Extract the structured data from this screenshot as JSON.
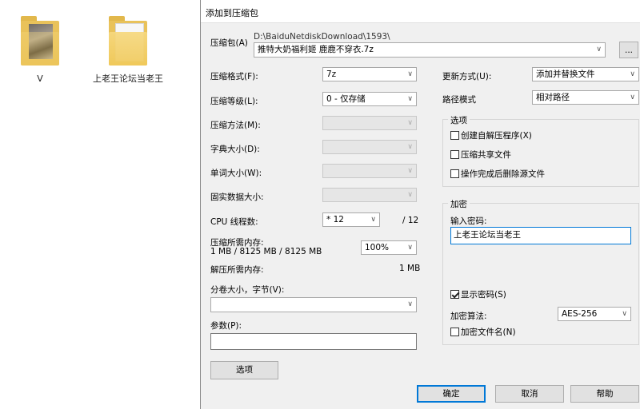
{
  "desktop": {
    "icons": [
      {
        "label": "V"
      },
      {
        "label": "上老王论坛当老王"
      }
    ]
  },
  "dialog": {
    "title": "添加到压缩包",
    "archive": {
      "label": "压缩包(A)",
      "path": "D:\\BaiduNetdiskDownload\\1593\\",
      "name": "推特大奶福利姬 鹿鹿不穿衣.7z",
      "browse": "..."
    },
    "format": {
      "label": "压缩格式(F):",
      "value": "7z"
    },
    "level": {
      "label": "压缩等级(L):",
      "value": "0 - 仅存储"
    },
    "method": {
      "label": "压缩方法(M):",
      "value": ""
    },
    "dict": {
      "label": "字典大小(D):",
      "value": ""
    },
    "word": {
      "label": "单词大小(W):",
      "value": ""
    },
    "solid": {
      "label": "固实数据大小:",
      "value": ""
    },
    "cpu": {
      "label": "CPU 线程数:",
      "value": "* 12",
      "max": "/ 12"
    },
    "mem_compress": {
      "label": "压缩所需内存:",
      "detail": "1 MB / 8125 MB / 8125 MB",
      "value": "100%"
    },
    "mem_decompress": {
      "label": "解压所需内存:",
      "value": "1 MB"
    },
    "volume": {
      "label": "分卷大小，字节(V):",
      "value": ""
    },
    "params": {
      "label": "参数(P):",
      "value": ""
    },
    "options_button": "选项",
    "update": {
      "label": "更新方式(U):",
      "value": "添加并替换文件"
    },
    "pathmode": {
      "label": "路径模式",
      "value": "相对路径"
    },
    "options_group": {
      "title": "选项",
      "items": [
        {
          "label": "创建自解压程序(X)",
          "checked": false
        },
        {
          "label": "压缩共享文件",
          "checked": false
        },
        {
          "label": "操作完成后删除源文件",
          "checked": false
        }
      ]
    },
    "encryption": {
      "title": "加密",
      "password_label": "输入密码:",
      "password": "上老王论坛当老王",
      "show_password": {
        "label": "显示密码(S)",
        "checked": true
      },
      "method_label": "加密算法:",
      "method": "AES-256",
      "encrypt_names": {
        "label": "加密文件名(N)",
        "checked": false
      }
    },
    "buttons": {
      "ok": "确定",
      "cancel": "取消",
      "help": "帮助"
    }
  }
}
